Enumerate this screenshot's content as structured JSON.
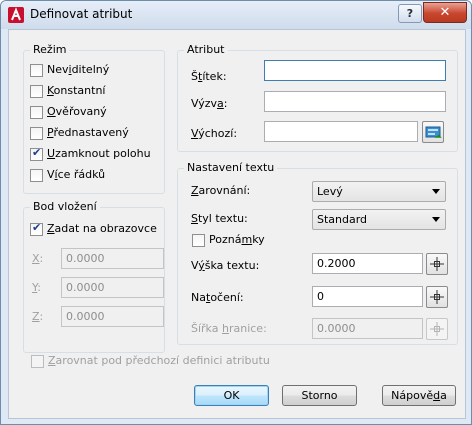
{
  "window": {
    "title": "Definovat atribut",
    "help": "?",
    "close": "✕"
  },
  "mode": {
    "title": "Režim",
    "items": [
      {
        "pre": "Nev",
        "u": "i",
        "post": "ditelný",
        "checked": false
      },
      {
        "pre": "",
        "u": "K",
        "post": "onstantní",
        "checked": false
      },
      {
        "pre": "",
        "u": "O",
        "post": "věřovaný",
        "checked": false
      },
      {
        "pre": "",
        "u": "P",
        "post": "řednastavený",
        "checked": false
      },
      {
        "pre": "",
        "u": "U",
        "post": "zamknout polohu",
        "checked": true
      },
      {
        "pre": "V",
        "u": "í",
        "post": "ce řádků",
        "checked": false
      }
    ]
  },
  "insertion": {
    "title": "Bod vložení",
    "on_screen": {
      "pre": "",
      "u": "Z",
      "post": "adat na obrazovce",
      "checked": true
    },
    "x": {
      "label": "X",
      "suffix": ":",
      "value": "0.0000"
    },
    "y": {
      "label": "Y",
      "suffix": ":",
      "value": "0.0000"
    },
    "z": {
      "label": "Z",
      "suffix": ":",
      "value": "0.0000"
    }
  },
  "attribute": {
    "title": "Atribut",
    "tag": {
      "pre": "Š",
      "u": "t",
      "post": "ítek:",
      "value": ""
    },
    "prompt": {
      "pre": "Výzv",
      "u": "a",
      "post": ":",
      "value": ""
    },
    "default": {
      "pre": "",
      "u": "V",
      "post": "ýchozí:",
      "value": ""
    }
  },
  "text": {
    "title": "Nastavení textu",
    "justification": {
      "pre": "",
      "u": "Z",
      "post": "arovnání:",
      "value": "Levý"
    },
    "style": {
      "pre": "",
      "u": "S",
      "post": "tyl textu:",
      "value": "Standard"
    },
    "annotative": {
      "pre": "Pozná",
      "u": "m",
      "post": "ky",
      "checked": false
    },
    "height": {
      "pre": "V",
      "u": "ý",
      "post": "ška textu:",
      "value": "0.2000"
    },
    "rotation": {
      "pre": "Na",
      "u": "t",
      "post": "očení:",
      "value": "0"
    },
    "width": {
      "pre": "Šířka ",
      "u": "h",
      "post": "ranice:",
      "value": "0.0000"
    }
  },
  "align_below": {
    "pre": "",
    "u": "Z",
    "post": "arovnat pod předchozí definici atributu",
    "checked": false
  },
  "buttons": {
    "ok": "OK",
    "cancel": "Storno",
    "help": {
      "pre": "Nápově",
      "u": "d",
      "post": "a"
    }
  },
  "colors": {
    "accent": "#3c7fb1",
    "check": "#1f3e8c",
    "close": "#c9462e",
    "disabled_text": "#a0a0a0"
  }
}
